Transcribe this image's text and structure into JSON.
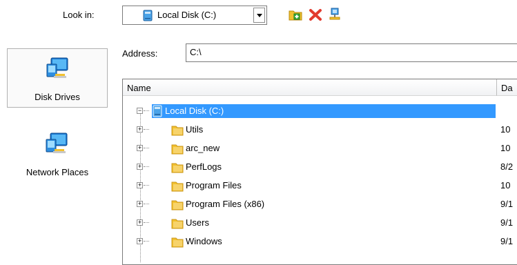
{
  "look_in": {
    "label": "Look in:",
    "value": "Local Disk (C:)"
  },
  "toolbar": {
    "new_folder_icon": "new-folder-icon",
    "delete_icon": "delete-icon",
    "network_icon": "network-drive-icon"
  },
  "nav": {
    "items": [
      {
        "label": "Disk Drives",
        "icon": "computer-monitor-icon",
        "selected": true
      },
      {
        "label": "Network Places",
        "icon": "computer-monitor-icon",
        "selected": false
      }
    ]
  },
  "address": {
    "label": "Address:",
    "value": "C:\\"
  },
  "tree": {
    "columns": [
      "Name",
      "Da"
    ],
    "root": {
      "name": "Local Disk (C:)",
      "expander": "−"
    },
    "items": [
      {
        "name": "Utils",
        "date": "10",
        "expander": "+"
      },
      {
        "name": "arc_new",
        "date": "10",
        "expander": "+"
      },
      {
        "name": "PerfLogs",
        "date": "8/2",
        "expander": "+"
      },
      {
        "name": "Program Files",
        "date": "10",
        "expander": "+"
      },
      {
        "name": "Program Files (x86)",
        "date": "9/1",
        "expander": "+"
      },
      {
        "name": "Users",
        "date": "9/1",
        "expander": "+"
      },
      {
        "name": "Windows",
        "date": "9/1",
        "expander": "+"
      }
    ]
  },
  "colors": {
    "selection": "#3399ff",
    "folder": "#f2c12e",
    "drive": "#3a8fd6"
  }
}
